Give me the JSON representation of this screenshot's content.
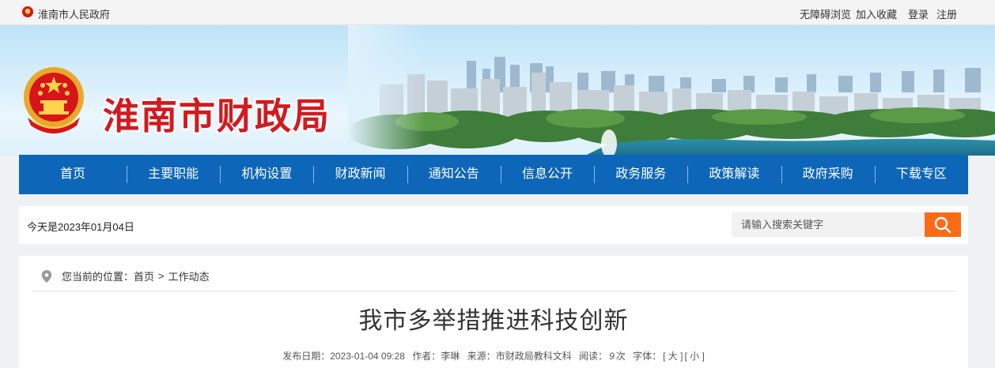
{
  "topbar": {
    "gov_name": "淮南市人民政府",
    "accessibility": "无障碍浏览",
    "favorite": "加入收藏",
    "login": "登录",
    "register": "注册"
  },
  "header": {
    "site_title": "淮南市财政局",
    "title_color": "#d21a1f"
  },
  "nav": {
    "items": [
      "首页",
      "主要职能",
      "机构设置",
      "财政新闻",
      "通知公告",
      "信息公开",
      "政务服务",
      "政策解读",
      "政府采购",
      "下载专区"
    ],
    "background": "#0d66b8"
  },
  "infobar": {
    "today": "今天是2023年01月04日",
    "search_placeholder": "请输入搜索关键字",
    "search_button_color": "#ff6a14"
  },
  "breadcrumb": {
    "prefix": "您当前的位置：",
    "home": "首页",
    "separator": ">",
    "current": "工作动态"
  },
  "article": {
    "title": "我市多举措推进科技创新",
    "publish_label": "发布日期：",
    "publish_date": "2023-01-04 09:28",
    "author_label": "作者：",
    "author": "李琳",
    "source_label": "来源：",
    "source": "市财政局教科文科",
    "views_label": "阅读：",
    "views": "9",
    "views_unit": "次",
    "font_label": "字体：",
    "font_large": "[ 大 ]",
    "font_small": "[ 小 ]"
  }
}
